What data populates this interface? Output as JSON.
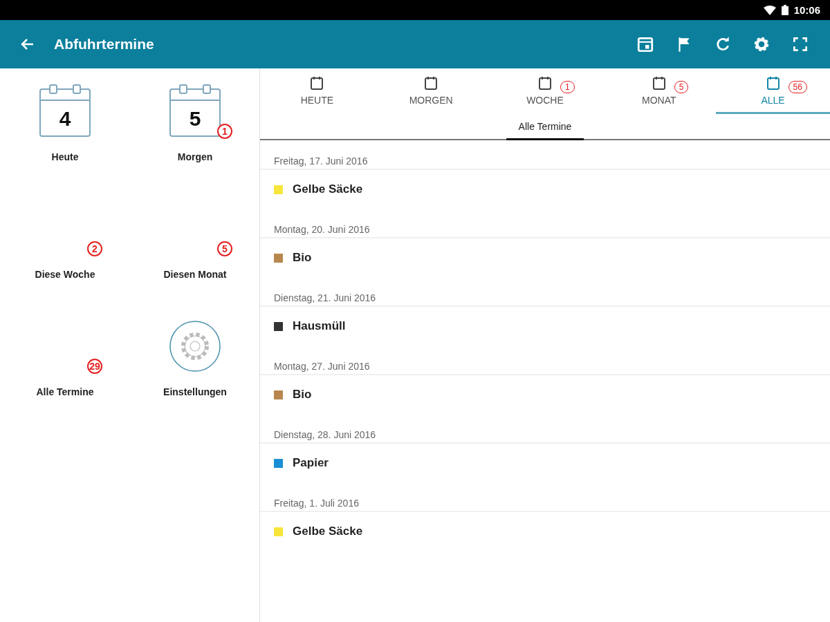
{
  "status_bar": {
    "time": "10:06"
  },
  "app_bar": {
    "title": "Abfuhrtermine"
  },
  "sidebar": {
    "items": [
      {
        "label": "Heute",
        "kind": "calendar",
        "day": "4"
      },
      {
        "label": "Morgen",
        "kind": "calendar",
        "day": "5",
        "badge": "1"
      },
      {
        "label": "Diese Woche",
        "kind": "blank",
        "badge": "2"
      },
      {
        "label": "Diesen Monat",
        "kind": "blank",
        "badge": "5"
      },
      {
        "label": "Alle Termine",
        "kind": "blank",
        "badge": "29"
      },
      {
        "label": "Einstellungen",
        "kind": "settings"
      }
    ]
  },
  "tabs": [
    {
      "label": "HEUTE",
      "selected": false
    },
    {
      "label": "MORGEN",
      "selected": false
    },
    {
      "label": "WOCHE",
      "selected": false,
      "badge": "1"
    },
    {
      "label": "MONAT",
      "selected": false,
      "badge": "5"
    },
    {
      "label": "ALLE",
      "selected": true,
      "badge": "56"
    }
  ],
  "subtab": {
    "label": "Alle Termine",
    "selected": true
  },
  "schedule": [
    {
      "date": "Freitag, 17. Juni 2016",
      "items": [
        {
          "name": "Gelbe Säcke",
          "color": "#f7e53b"
        }
      ]
    },
    {
      "date": "Montag, 20. Juni 2016",
      "items": [
        {
          "name": "Bio",
          "color": "#b8874e"
        }
      ]
    },
    {
      "date": "Dienstag, 21. Juni 2016",
      "items": [
        {
          "name": "Hausmüll",
          "color": "#333333"
        }
      ]
    },
    {
      "date": "Montag, 27. Juni 2016",
      "items": [
        {
          "name": "Bio",
          "color": "#b8874e"
        }
      ]
    },
    {
      "date": "Dienstag, 28. Juni 2016",
      "items": [
        {
          "name": "Papier",
          "color": "#1a8fd6"
        }
      ]
    },
    {
      "date": "Freitag, 1. Juli 2016",
      "items": [
        {
          "name": "Gelbe Säcke",
          "color": "#f7e53b"
        }
      ]
    }
  ]
}
